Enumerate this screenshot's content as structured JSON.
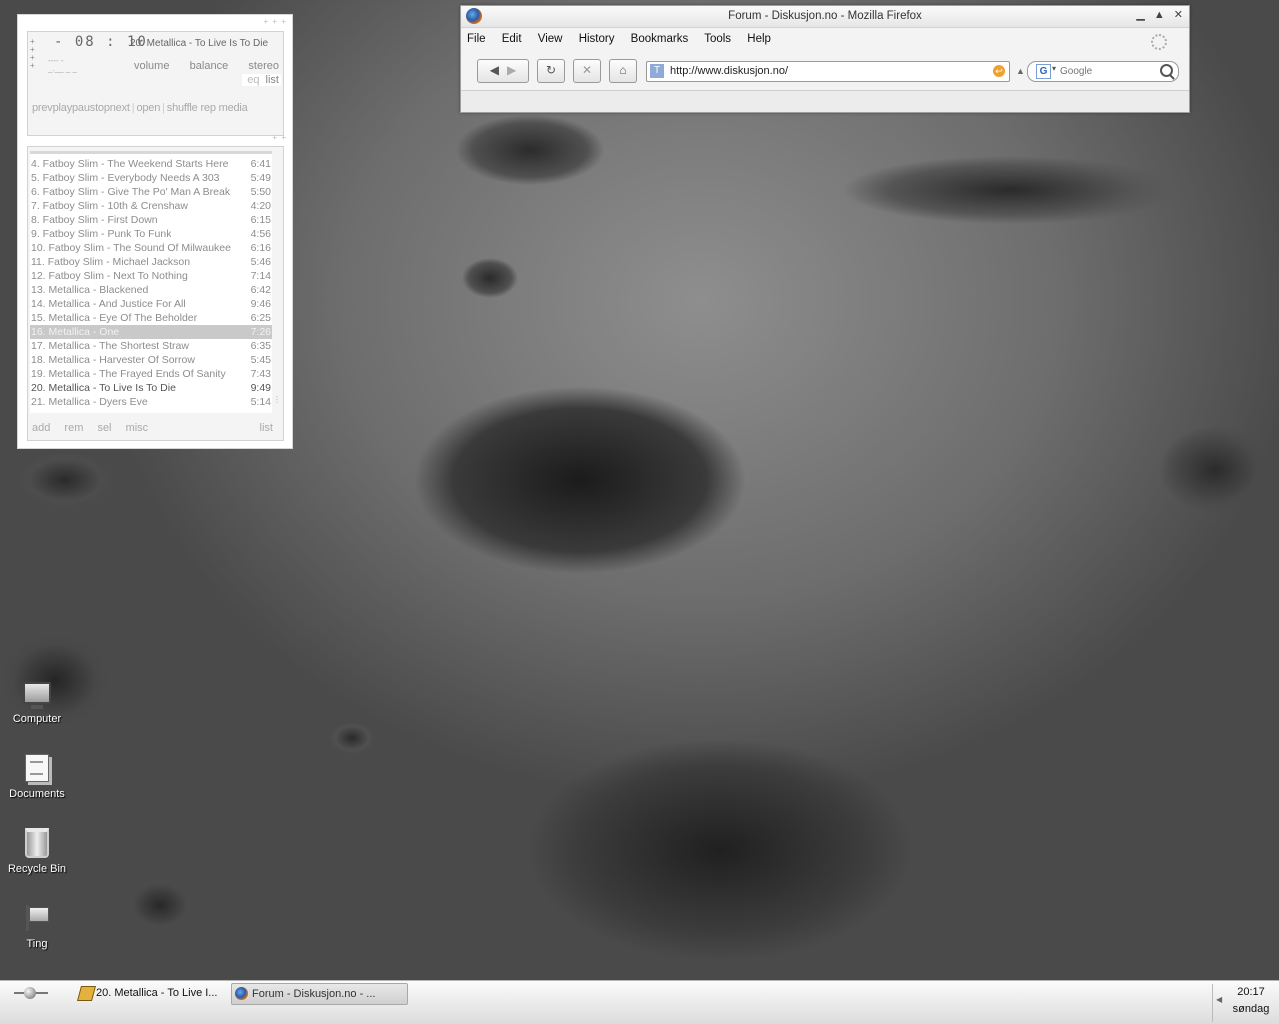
{
  "player": {
    "time": "- 08 : 10",
    "track_title": "20. Metallica - To Live Is To Die",
    "viz_text": "---- -\n_.__ _ _",
    "volume_label": "volume",
    "balance_label": "balance",
    "stereo_label": "stereo",
    "eq_label": "eq",
    "list_label": "list",
    "controls": {
      "prev": "prev",
      "play": "play",
      "pause": "pau",
      "stop": "stop",
      "next": "next",
      "open": "open",
      "shuffle": "shuffle",
      "repeat": "rep",
      "media": "media"
    }
  },
  "playlist": {
    "items": [
      {
        "name": "4. Fatboy Slim - The Weekend Starts Here",
        "time": "6:41"
      },
      {
        "name": "5. Fatboy Slim - Everybody Needs A 303",
        "time": "5:49"
      },
      {
        "name": "6. Fatboy Slim - Give The Po' Man A Break",
        "time": "5:50"
      },
      {
        "name": "7. Fatboy Slim - 10th & Crenshaw",
        "time": "4:20"
      },
      {
        "name": "8. Fatboy Slim - First Down",
        "time": "6:15"
      },
      {
        "name": "9. Fatboy Slim - Punk To Funk",
        "time": "4:56"
      },
      {
        "name": "10. Fatboy Slim - The Sound Of Milwaukee",
        "time": "6:16"
      },
      {
        "name": "11. Fatboy Slim - Michael Jackson",
        "time": "5:46"
      },
      {
        "name": "12. Fatboy Slim - Next To Nothing",
        "time": "7:14"
      },
      {
        "name": "13. Metallica - Blackened",
        "time": "6:42"
      },
      {
        "name": "14. Metallica - And Justice For All",
        "time": "9:46"
      },
      {
        "name": "15. Metallica - Eye Of The Beholder",
        "time": "6:25"
      },
      {
        "name": "16. Metallica - One",
        "time": "7:26"
      },
      {
        "name": "17. Metallica - The Shortest Straw",
        "time": "6:35"
      },
      {
        "name": "18. Metallica - Harvester Of Sorrow",
        "time": "5:45"
      },
      {
        "name": "19. Metallica - The Frayed Ends Of Sanity",
        "time": "7:43"
      },
      {
        "name": "20. Metallica - To Live Is To Die",
        "time": "9:49"
      },
      {
        "name": "21. Metallica - Dyers Eve",
        "time": "5:14"
      }
    ],
    "buttons": {
      "add": "add",
      "rem": "rem",
      "sel": "sel",
      "misc": "misc",
      "list": "list"
    }
  },
  "firefox": {
    "title": "Forum - Diskusjon.no - Mozilla Firefox",
    "menu": [
      "File",
      "Edit",
      "View",
      "History",
      "Bookmarks",
      "Tools",
      "Help"
    ],
    "url": "http://www.diskusjon.no/",
    "search_placeholder": "Google"
  },
  "desktop_icons": [
    {
      "label": "Computer",
      "icon": "computer-icon"
    },
    {
      "label": "Documents",
      "icon": "documents-icon"
    },
    {
      "label": "Recycle Bin",
      "icon": "recycle-bin-icon"
    },
    {
      "label": "Ting",
      "icon": "folder-flag-icon"
    }
  ],
  "taskbar": {
    "tasks": [
      {
        "label": "20. Metallica - To Live I...",
        "icon": "winamp-icon"
      },
      {
        "label": "Forum - Diskusjon.no - ...",
        "icon": "firefox-icon"
      }
    ],
    "clock_time": "20:17",
    "clock_day": "søndag"
  },
  "colors": {
    "selected_row": "#c9c9c9",
    "accent_orange": "#f0a030"
  }
}
